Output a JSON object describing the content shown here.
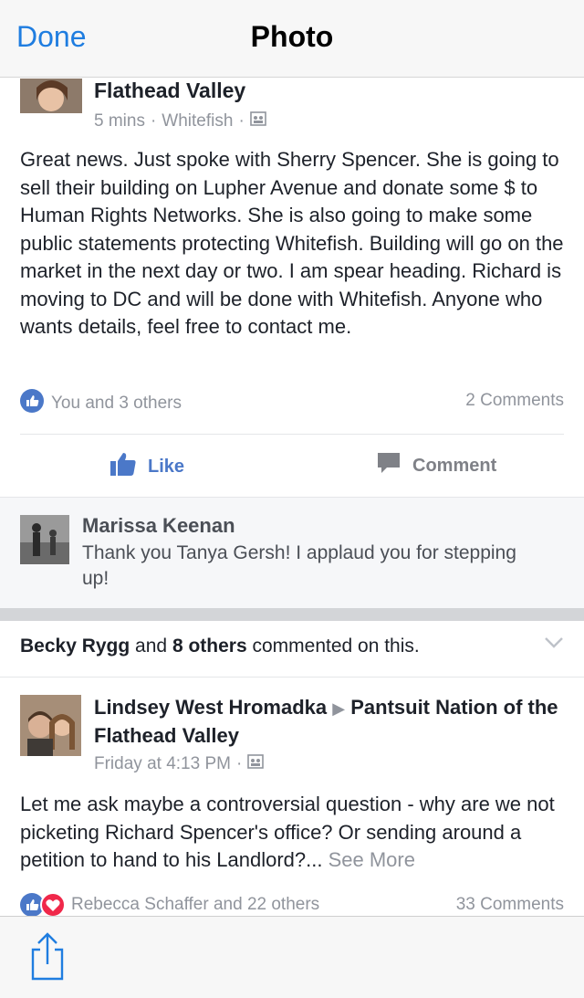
{
  "nav": {
    "done_label": "Done",
    "title": "Photo"
  },
  "post1": {
    "author": "Flathead Valley",
    "time": "5 mins",
    "location": "Whitefish",
    "body": "Great news. Just spoke with Sherry Spencer. She is going to sell their building on Lupher Avenue and donate some $ to Human Rights Networks. She is also going to make some public statements protecting Whitefish. Building will go on the market in the next day or two. I am spear heading. Richard is moving to DC and will be done with Whitefish. Anyone who wants details, feel free to contact me.",
    "reactions": "You and 3 others",
    "comments": "2 Comments",
    "like_label": "Like",
    "comment_label": "Comment"
  },
  "comment": {
    "author": "Marissa Keenan",
    "text": "Thank you Tanya Gersh! I applaud you for stepping up!"
  },
  "social": {
    "name": "Becky Rygg",
    "and": " and ",
    "others": "8 others",
    "suffix": " commented on this."
  },
  "post2": {
    "author": "Lindsey West Hromadka",
    "arrow": "▶",
    "group": "Pantsuit Nation of the Flathead Valley",
    "time": "Friday at 4:13 PM",
    "body": "Let me ask maybe a controversial question - why are we not picketing Richard Spencer's office? Or sending around a petition to hand to his Landlord?...",
    "see_more": "See More",
    "reactions": "Rebecca Schaffer and 22 others",
    "comments": "33 Comments"
  },
  "colors": {
    "accent": "#1f7de0",
    "like_blue": "#4b78c8",
    "love_red": "#f0284a",
    "meta_gray": "#90949c"
  },
  "icons": [
    "share-icon",
    "like-thumb-icon",
    "comment-bubble-icon",
    "chevron-down-icon",
    "audience-icon",
    "love-heart-icon"
  ]
}
